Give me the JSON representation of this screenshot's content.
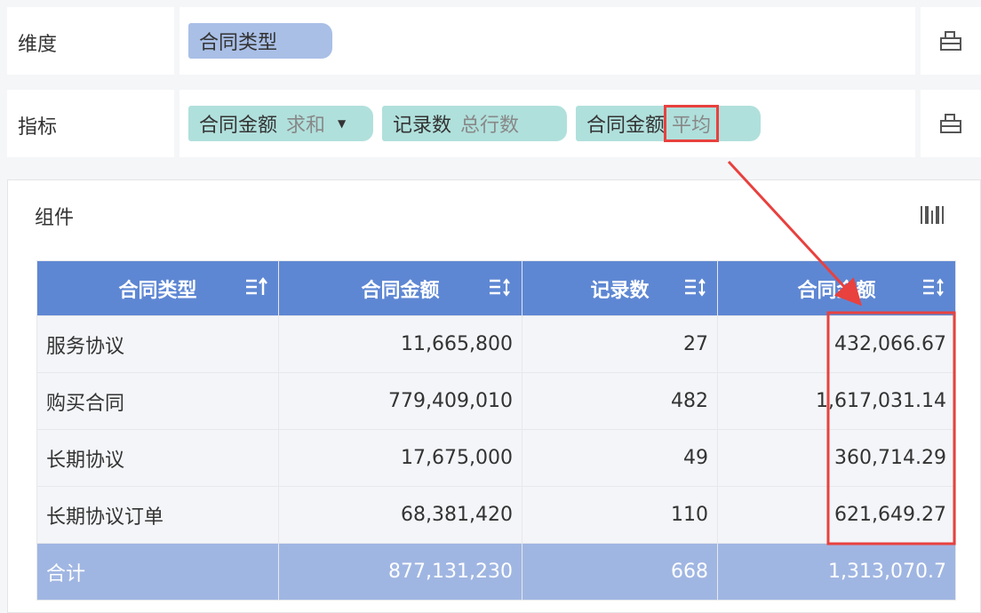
{
  "dimension_row": {
    "label": "维度",
    "pills": [
      {
        "text": "合同类型"
      }
    ]
  },
  "metric_row": {
    "label": "指标",
    "pills": [
      {
        "name": "合同金额",
        "agg": "求和",
        "has_dropdown": true
      },
      {
        "name": "记录数",
        "agg": "总行数",
        "has_dropdown": false
      },
      {
        "name": "合同金额",
        "agg": "平均",
        "has_dropdown": false,
        "highlighted": true
      }
    ]
  },
  "component": {
    "title": "组件",
    "table": {
      "headers": [
        "合同类型",
        "合同金额",
        "记录数",
        "合同金额"
      ],
      "rows": [
        [
          "服务协议",
          "11,665,800",
          "27",
          "432,066.67"
        ],
        [
          "购买合同",
          "779,409,010",
          "482",
          "1,617,031.14"
        ],
        [
          "长期协议",
          "17,675,000",
          "49",
          "360,714.29"
        ],
        [
          "长期协议订单",
          "68,381,420",
          "110",
          "621,649.27"
        ]
      ],
      "total": [
        "合计",
        "877,131,230",
        "668",
        "1,313,070.7"
      ]
    }
  },
  "colors": {
    "header_bg": "#5e87d3",
    "total_bg": "#a0b6e2",
    "dimension_pill": "#a9bfe6",
    "metric_pill": "#b0e0dc",
    "highlight": "#e8413e"
  },
  "icons": {
    "row_settings": "layout-settings-icon",
    "component_chart": "barcode-chart-icon",
    "sort": "sort-icon"
  }
}
